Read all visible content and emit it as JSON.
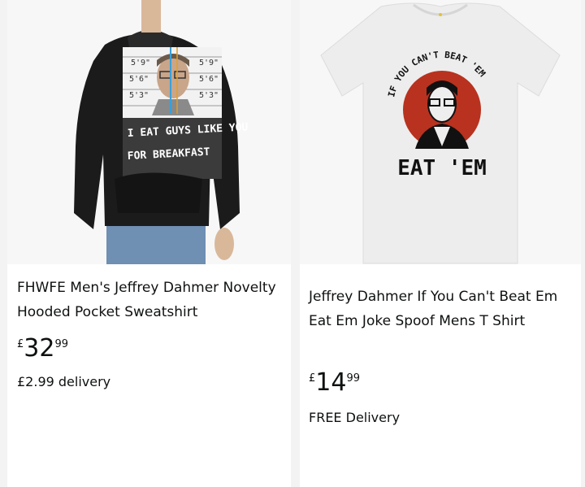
{
  "products": [
    {
      "title": "FHWFE Men's Jeffrey Dahmer Novelty Hooded Pocket Sweatshirt",
      "price_symbol": "£",
      "price_whole": "32",
      "price_fraction": "99",
      "delivery": "£2.99 delivery",
      "image": {
        "height_marks": [
          "5'9\"",
          "5'6\"",
          "5'3\"",
          "5'9\"",
          "5'6\"",
          "5'3\""
        ],
        "print_line_1": "I EAT GUYS LIKE YOU",
        "print_line_2": "FOR BREAKFAST"
      }
    },
    {
      "title": "Jeffrey Dahmer If You Can't Beat Em Eat Em Joke Spoof Mens T Shirt",
      "price_symbol": "£",
      "price_whole": "14",
      "price_fraction": "99",
      "delivery": "FREE Delivery",
      "image": {
        "arc_text": "IF YOU CAN'T BEAT 'EM",
        "main_text": "EAT 'EM"
      }
    }
  ],
  "colors": {
    "page_bg": "#f3f3f3",
    "card_bg": "#ffffff",
    "image_bg": "#f7f7f7",
    "hoodie": "#1b1b1b",
    "tshirt": "#ededed",
    "red_circle": "#b8321f"
  }
}
